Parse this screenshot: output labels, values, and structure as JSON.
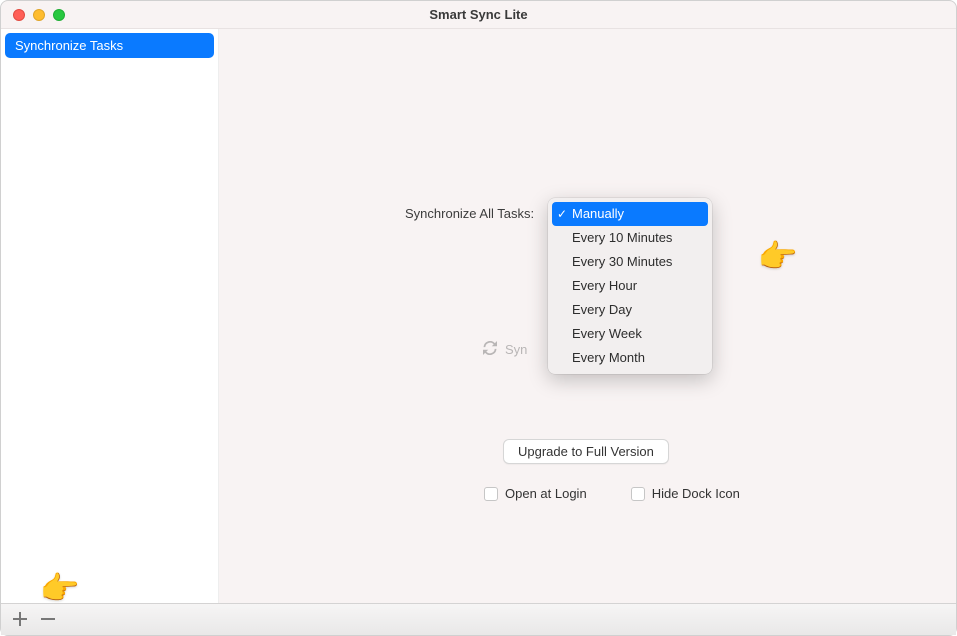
{
  "window": {
    "title": "Smart Sync Lite"
  },
  "sidebar": {
    "items": [
      {
        "label": "Synchronize Tasks"
      }
    ]
  },
  "main": {
    "sync_label": "Synchronize All Tasks:",
    "sync_now_label": "Syn",
    "upgrade_label": "Upgrade to Full Version",
    "open_at_login_label": "Open at Login",
    "hide_dock_label": "Hide Dock Icon"
  },
  "dropdown": {
    "options": [
      "Manually",
      "Every 10 Minutes",
      "Every 30 Minutes",
      "Every Hour",
      "Every Day",
      "Every Week",
      "Every Month"
    ],
    "selected_index": 0
  },
  "icons": {
    "hand": "👈"
  }
}
